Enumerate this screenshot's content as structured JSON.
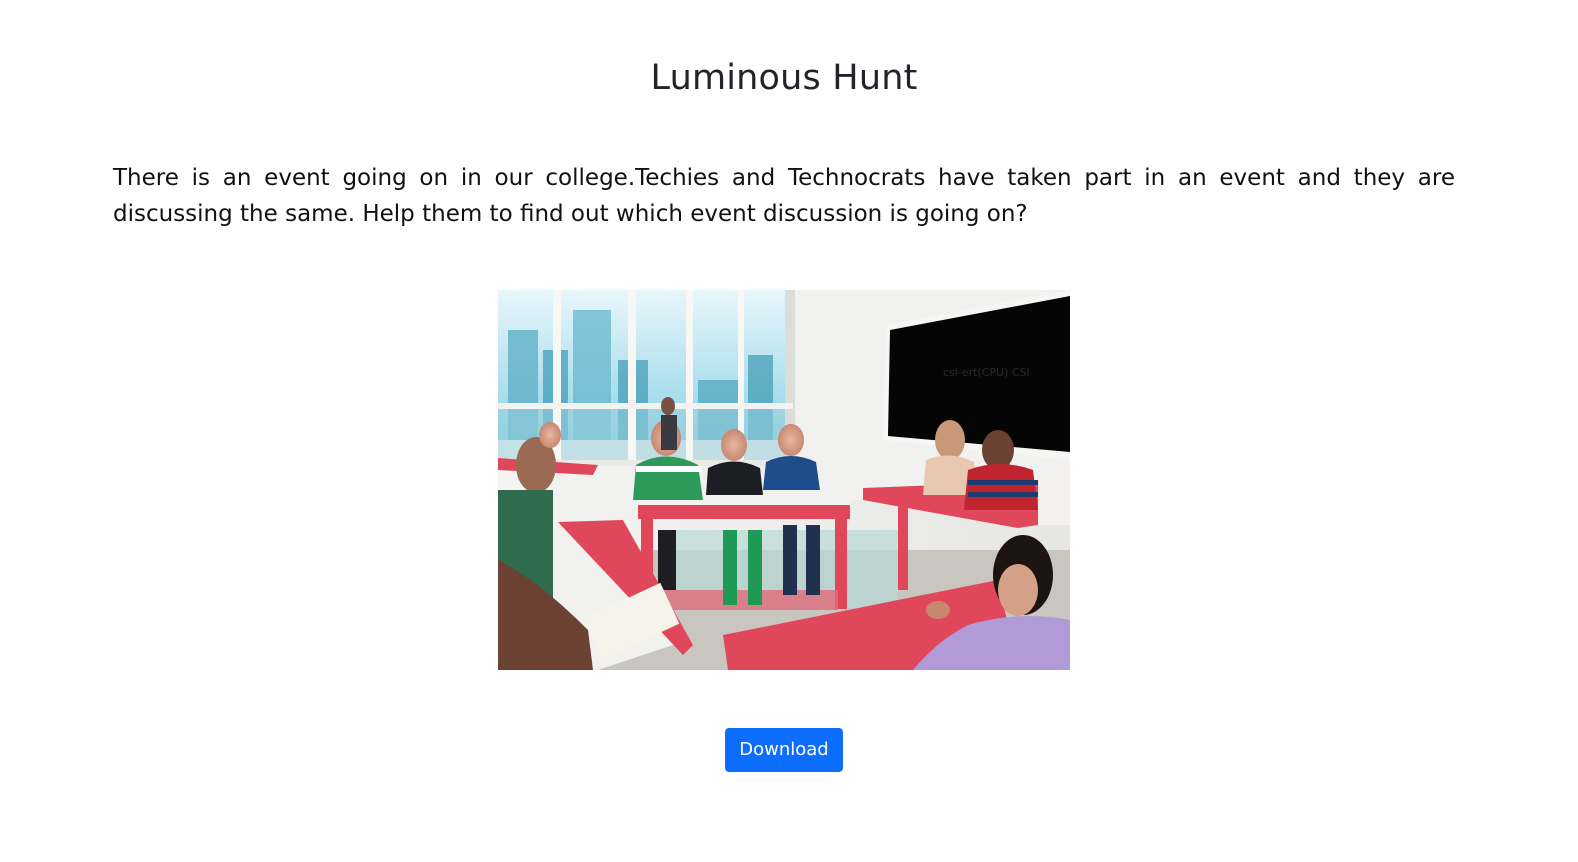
{
  "page": {
    "title": "Luminous Hunt",
    "description": "There is an event going on in our college.Techies and Technocrats have taken part in an event and they are discussing the same. Help them to find out which event discussion is going on?",
    "photo_board_text": "csi-ert(CPU) CSI"
  },
  "actions": {
    "download_label": "Download"
  },
  "colors": {
    "button_bg": "#0d6efd",
    "button_text": "#ffffff",
    "desk_red": "#e0475a",
    "board_black": "#050505"
  }
}
